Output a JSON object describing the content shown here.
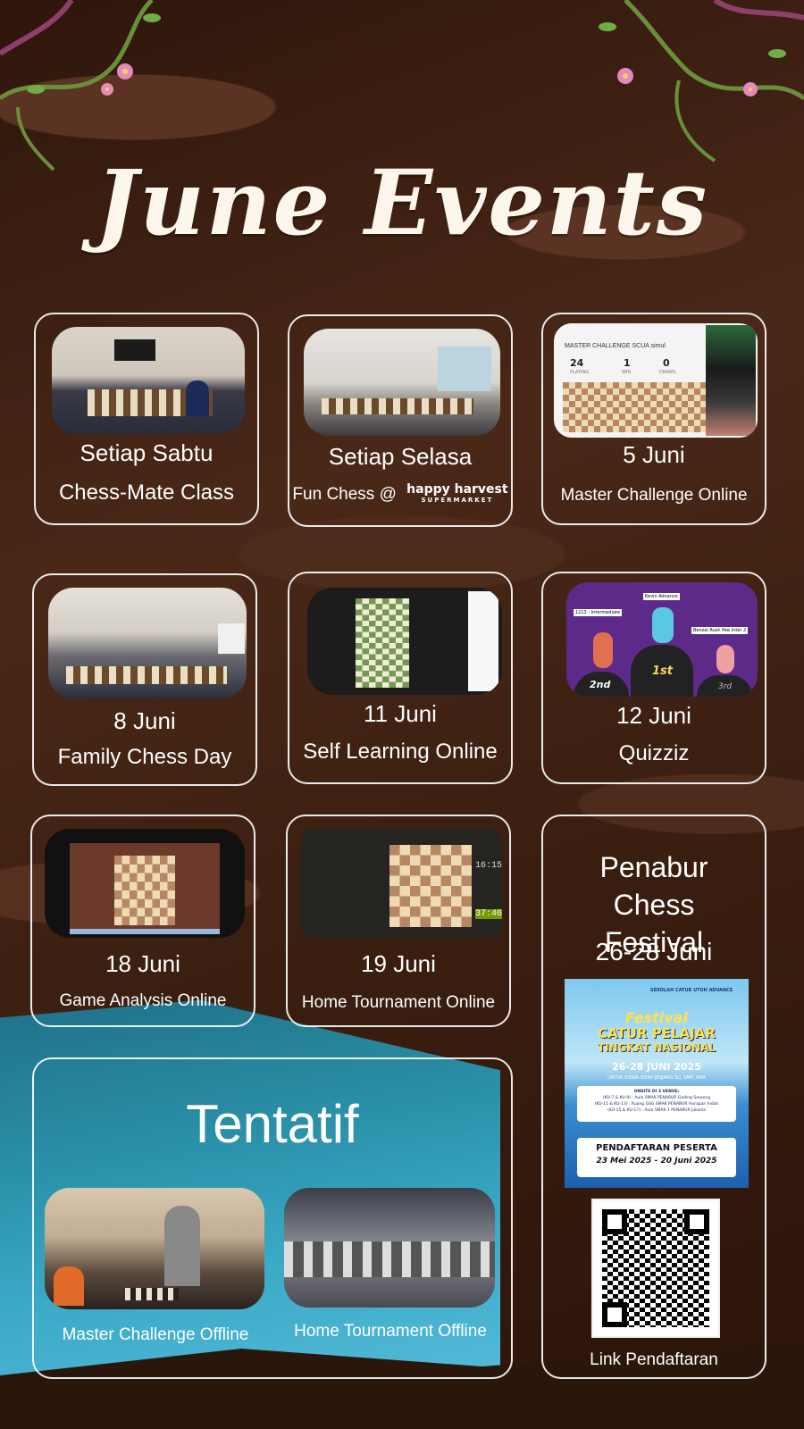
{
  "title": "June Events",
  "colors": {
    "background": "#3a1f12",
    "water": "#2a90a8",
    "text": "#ffffff"
  },
  "events": [
    {
      "day": "Setiap Sabtu",
      "name": "Chess-Mate Class"
    },
    {
      "day": "Setiap Selasa",
      "name": "Fun Chess @",
      "partner": "happy harvest",
      "partner_sub": "SUPERMARKET"
    },
    {
      "day": "5 Juni",
      "name": "Master Challenge Online",
      "screen": {
        "header": "MASTER CHALLENGE SCUA simul",
        "playing": "24",
        "playing_label": "PLAYING",
        "win": "1",
        "win_label": "WIN",
        "draws": "0",
        "draws_label": "DRAWS"
      }
    },
    {
      "day": "8 Juni",
      "name": "Family Chess Day"
    },
    {
      "day": "11 Juni",
      "name": "Self Learning Online"
    },
    {
      "day": "12 Juni",
      "name": "Quizziz",
      "podium": {
        "first": "1st",
        "second": "2nd",
        "third": "3rd",
        "first_name": "Kevin Advance",
        "second_name": "1213 - Intermediate",
        "third_name": "Benzal Rush Pee Inter 2"
      }
    },
    {
      "day": "18 Juni",
      "name": "Game Analysis Online"
    },
    {
      "day": "19 Juni",
      "name": "Home Tournament Online",
      "clock_top": "16:15",
      "clock_bottom": "37:46"
    }
  ],
  "festival": {
    "name": "Penabur Chess Festival",
    "dates": "26-28 Juni",
    "poster": {
      "org": "SEKOLAH CATUR UTUH ADVANCE",
      "fest": "Festival",
      "line1": "CATUR PELAJAR",
      "line2": "TINGKAT NASIONAL",
      "dates": "26-28 JUNI 2025",
      "for": "UNTUK SISWA-SISWI JENJANG SD, SMP, SMA",
      "venue_title": "ONSITE DI 3 VENUE:",
      "venue1": "(KU-7 & KU-9) : Aula SMAK PENABUR Gading Serpong",
      "venue2": "(KU-11 & KU-13) : Ruang GSG SMAK PENABUR Harapan Indah",
      "venue3": "(KU-15 & KU-17) : Aula SMAK 1 PENABUR Jakarta",
      "reg": "PENDAFTARAN PESERTA",
      "reg_dates": "23 Mei 2025 - 20 Juni 2025"
    },
    "link_label": "Link Pendaftaran"
  },
  "tentatif": {
    "heading": "Tentatif",
    "items": [
      {
        "name": "Master Challenge Offline"
      },
      {
        "name": "Home Tournament Offline"
      }
    ]
  }
}
